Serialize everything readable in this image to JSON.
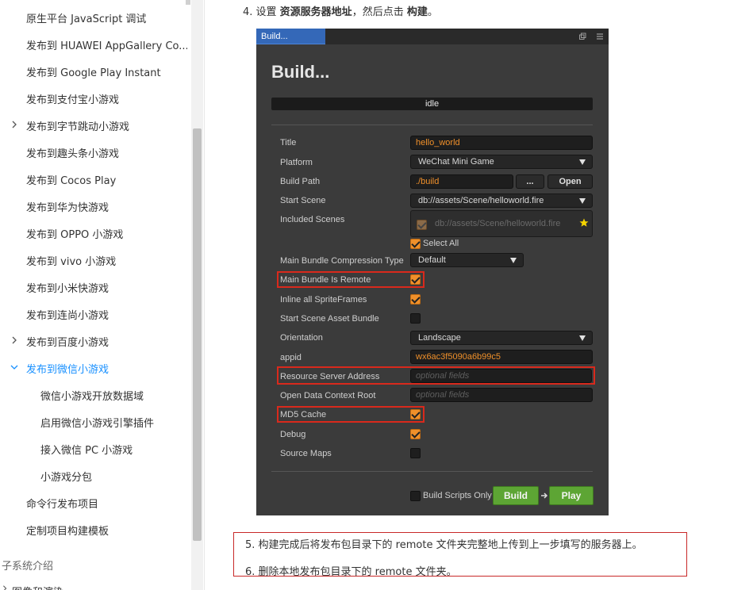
{
  "sidebar": {
    "items": [
      {
        "label": "原生平台 JavaScript 调试"
      },
      {
        "label": "发布到 HUAWEI AppGallery Co..."
      },
      {
        "label": "发布到 Google Play Instant"
      },
      {
        "label": "发布到支付宝小游戏"
      },
      {
        "label": "发布到字节跳动小游戏"
      },
      {
        "label": "发布到趣头条小游戏"
      },
      {
        "label": "发布到 Cocos Play"
      },
      {
        "label": "发布到华为快游戏"
      },
      {
        "label": "发布到 OPPO 小游戏"
      },
      {
        "label": "发布到 vivo 小游戏"
      },
      {
        "label": "发布到小米快游戏"
      },
      {
        "label": "发布到连尚小游戏"
      },
      {
        "label": "发布到百度小游戏"
      },
      {
        "label": "发布到微信小游戏"
      },
      {
        "label": "微信小游戏开放数据域"
      },
      {
        "label": "启用微信小游戏引擎插件"
      },
      {
        "label": "接入微信 PC 小游戏"
      },
      {
        "label": "小游戏分包"
      },
      {
        "label": "命令行发布项目"
      },
      {
        "label": "定制项目构建模板"
      }
    ],
    "section_label": "子系统介绍",
    "section_label_2": "图像和渲染"
  },
  "content": {
    "step4_prefix": "4. 设置 ",
    "step4_bold1": "资源服务器地址",
    "step4_mid": "，然后点击 ",
    "step4_bold2": "构建",
    "step4_suffix": "。",
    "step5": "5. 构建完成后将发布包目录下的 remote 文件夹完整地上传到上一步填写的服务器上。",
    "step6": "6. 删除本地发布包目录下的 remote 文件夹。"
  },
  "build_panel": {
    "tab_title": "Build...",
    "heading": "Build...",
    "status": "idle",
    "labels": {
      "title": "Title",
      "platform": "Platform",
      "build_path": "Build Path",
      "start_scene": "Start Scene",
      "included_scenes": "Included Scenes",
      "select_all": "Select All",
      "compression_type": "Main Bundle Compression Type",
      "bundle_remote": "Main Bundle Is Remote",
      "inline_sprites": "Inline all SpriteFrames",
      "start_scene_bundle": "Start Scene Asset Bundle",
      "orientation": "Orientation",
      "appid": "appid",
      "resource_server": "Resource Server Address",
      "open_data_root": "Open Data Context Root",
      "md5_cache": "MD5 Cache",
      "debug": "Debug",
      "source_maps": "Source Maps",
      "build_scripts_only": "Build Scripts Only"
    },
    "values": {
      "title": "hello_world",
      "platform": "WeChat Mini Game",
      "build_path": "./build",
      "browse_button": "...",
      "open_button": "Open",
      "start_scene": "db://assets/Scene/helloworld.fire",
      "included_scene": "db://assets/Scene/helloworld.fire",
      "compression_type": "Default",
      "orientation": "Landscape",
      "appid": "wx6ac3f5090a6b99c5",
      "resource_server_placeholder": "optional fields",
      "open_data_placeholder": "optional fields"
    },
    "checks": {
      "select_all": true,
      "bundle_remote": true,
      "inline_sprites": true,
      "start_scene_bundle": false,
      "md5_cache": true,
      "debug": true,
      "source_maps": false,
      "build_scripts_only": false
    },
    "buttons": {
      "build": "Build",
      "play": "Play"
    },
    "colors": {
      "accent": "#f0902a",
      "highlight": "#d9291c",
      "green": "#5da534",
      "tab": "#3468b8"
    }
  }
}
